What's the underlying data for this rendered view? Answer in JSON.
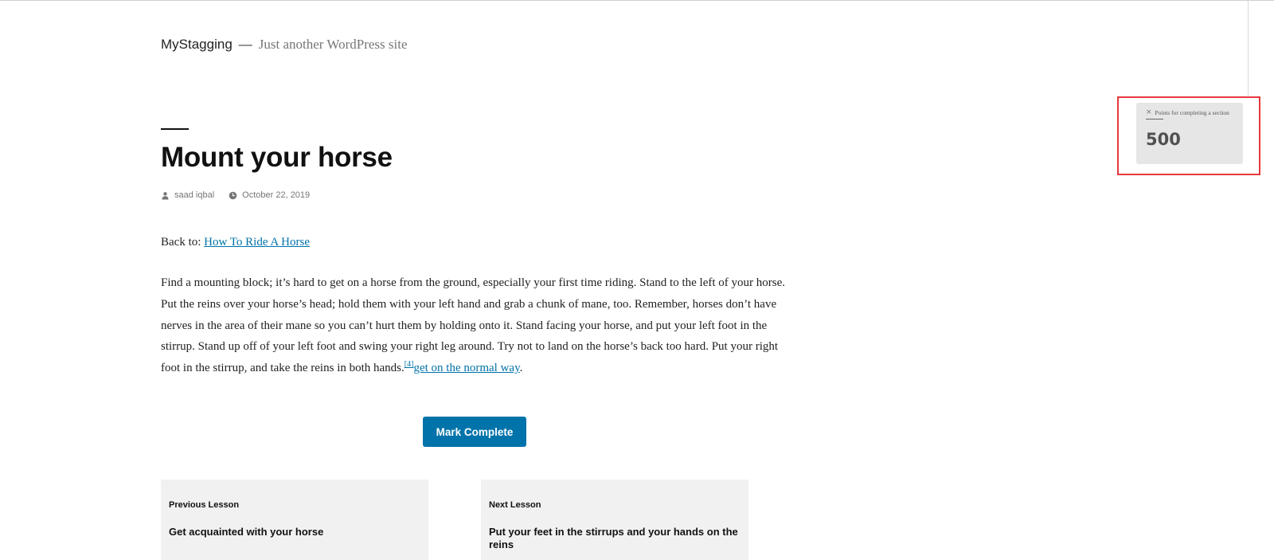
{
  "site": {
    "title": "MyStagging",
    "separator": "—",
    "description": "Just another WordPress site"
  },
  "post": {
    "title": "Mount your horse",
    "author": "saad iqbal",
    "date": "October 22, 2019",
    "back_to_label": "Back to:",
    "back_to_link": "How To Ride A Horse",
    "body_text": "Find a mounting block; it’s hard to get on a horse from the ground, especially your first time riding. Stand to the left of your horse. Put the reins over your horse’s head; hold them with your left hand and grab a chunk of mane, too. Remember, horses don’t have nerves in the area of their mane so you can’t hurt them by holding onto it. Stand facing your horse, and put your left foot in the stirrup. Stand up off of your left foot and swing your right leg around. Try not to land on the horse’s back too hard. Put your right foot in the stirrup, and take the reins in both hands.",
    "footnote": "[4]",
    "body_link": "get on the normal way",
    "body_end": "."
  },
  "actions": {
    "mark_complete_label": "Mark Complete"
  },
  "navigation": {
    "previous": {
      "kicker": "Previous Lesson",
      "title": "Get acquainted with your horse"
    },
    "next": {
      "kicker": "Next Lesson",
      "title": "Put your feet in the stirrups and your hands on the reins"
    }
  },
  "points_popup": {
    "close_glyph": "×",
    "label": "Points for completing a section",
    "value": "500"
  },
  "icons": {
    "author": "person-icon",
    "date": "clock-icon",
    "close": "close-icon"
  },
  "colors": {
    "link": "#0073aa",
    "button_bg": "#0073aa",
    "nav_card_bg": "#f1f1f1",
    "popup_bg": "#e6e6e6",
    "highlight_border": "#e8383d",
    "meta_text": "#767676"
  }
}
